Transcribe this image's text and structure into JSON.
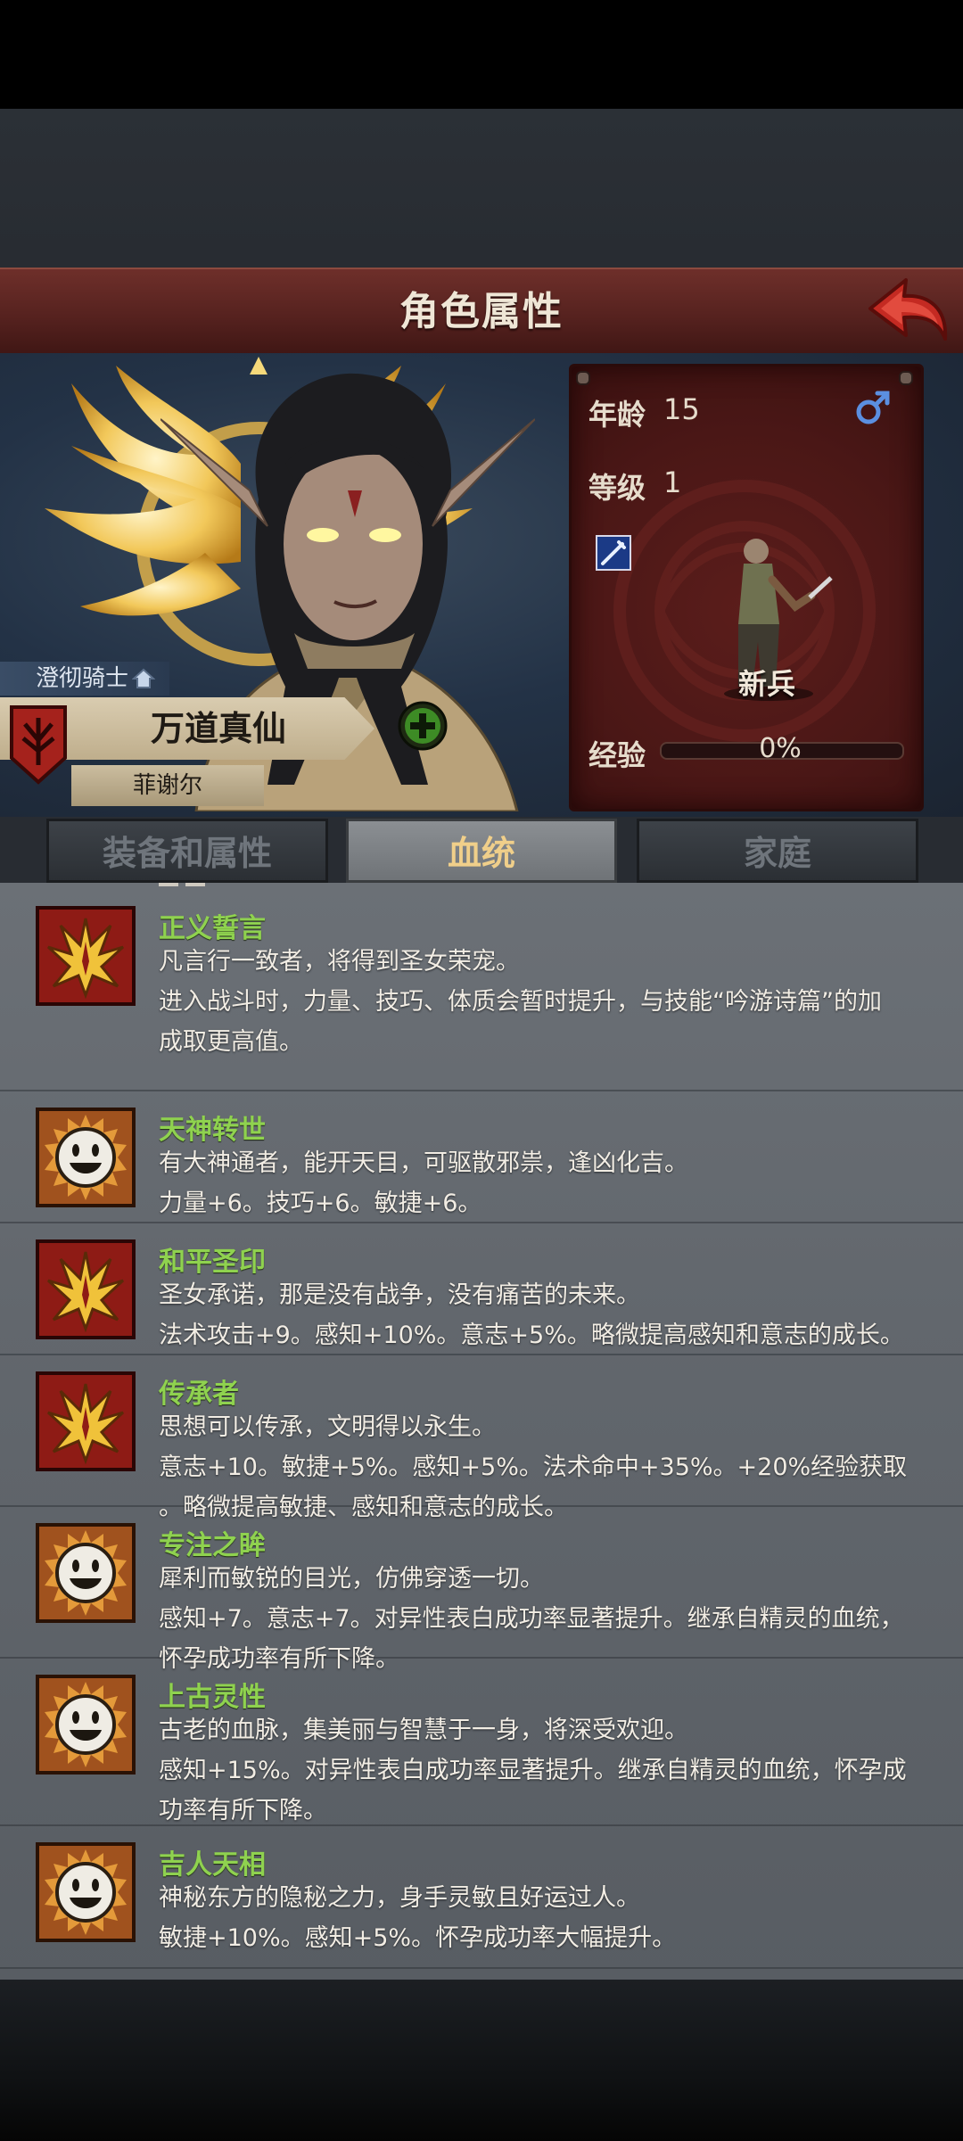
{
  "header": {
    "title": "角色属性"
  },
  "character": {
    "class_title": "澄彻骑士",
    "name": "万道真仙",
    "subname": "菲谢尔"
  },
  "stats": {
    "age_label": "年龄",
    "age_value": "15",
    "level_label": "等级",
    "level_value": "1",
    "rank": "新兵",
    "exp_label": "经验",
    "exp_percent": "0%",
    "exp_fraction": 0
  },
  "tabs": [
    {
      "label": "装备和属性",
      "active": false
    },
    {
      "label": "血统",
      "active": true
    },
    {
      "label": "家庭",
      "active": false
    }
  ],
  "traits": [
    {
      "name": "正义誓言",
      "icon": "red-flame-icon",
      "desc": "凡言行一致者，将得到圣女荣宠。\n进入战斗时，力量、技巧、体质会暂时提升，与技能“吟游诗篇”的加\n成取更高值。"
    },
    {
      "name": "天神转世",
      "icon": "smiley-sun-icon",
      "desc": "有大神通者，能开天目，可驱散邪祟，逢凶化吉。\n力量+6。技巧+6。敏捷+6。"
    },
    {
      "name": "和平圣印",
      "icon": "red-flame-icon",
      "desc": "圣女承诺，那是没有战争，没有痛苦的未来。\n法术攻击+9。感知+10%。意志+5%。略微提高感知和意志的成长。"
    },
    {
      "name": "传承者",
      "icon": "red-flame-icon",
      "desc": "思想可以传承，文明得以永生。\n意志+10。敏捷+5%。感知+5%。法术命中+35%。+20%经验获取\n。略微提高敏捷、感知和意志的成长。"
    },
    {
      "name": "专注之眸",
      "icon": "smiley-sun-icon",
      "desc": "犀利而敏锐的目光，仿佛穿透一切。\n感知+7。意志+7。对异性表白成功率显著提升。继承自精灵的血统，\n怀孕成功率有所下降。"
    },
    {
      "name": "上古灵性",
      "icon": "smiley-sun-icon",
      "desc": "古老的血脉，集美丽与智慧于一身，将深受欢迎。\n感知+15%。对异性表白成功率显著提升。继承自精灵的血统，怀孕成\n功率有所下降。"
    },
    {
      "name": "吉人天相",
      "icon": "smiley-sun-icon",
      "desc": "神秘东方的隐秘之力，身手灵敏且好运过人。\n敏捷+10%。感知+5%。怀孕成功率大幅提升。"
    }
  ],
  "colors": {
    "trait_name": "#8fd24f",
    "tab_active_text": "#f0cf8a",
    "title_bar": "#5a2420"
  }
}
